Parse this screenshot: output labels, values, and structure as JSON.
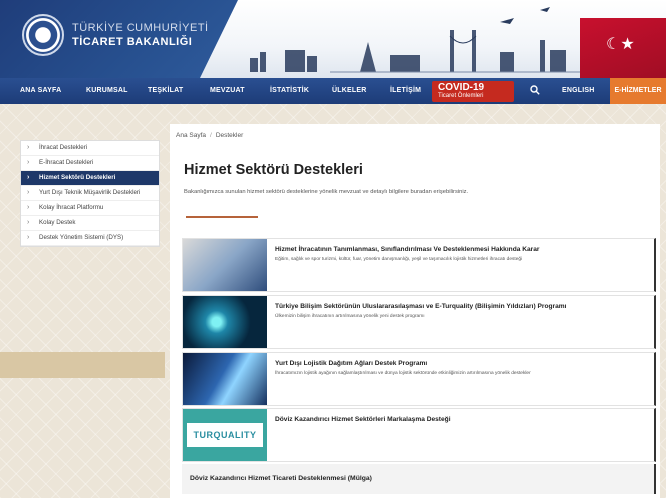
{
  "header": {
    "logo_line1": "TÜRKİYE CUMHURİYETİ",
    "logo_line2": "TİCARET BAKANLIĞI"
  },
  "nav": {
    "items": [
      "ANA SAYFA",
      "KURUMSAL",
      "TEŞKİLAT",
      "MEVZUAT",
      "İSTATİSTİK",
      "ÜLKELER",
      "İLETİŞİM"
    ],
    "covid_big": "COVID-19",
    "covid_small": "Ticaret Önlemleri",
    "english": "ENGLISH",
    "ehizmetler": "E-HİZMETLER"
  },
  "sidebar": {
    "items": [
      "İhracat Destekleri",
      "E-İhracat Destekleri",
      "Hizmet Sektörü Destekleri",
      "Yurt Dışı Teknik Müşavirlik Destekleri",
      "Kolay İhracat Platformu",
      "Kolay Destek",
      "Destek Yönetim Sistemi (DYS)"
    ],
    "active_index": 2
  },
  "breadcrumb": {
    "home": "Ana Sayfa",
    "sep": "/",
    "current": "Destekler"
  },
  "page": {
    "title": "Hizmet Sektörü Destekleri",
    "description": "Bakanlığımızca sunulan hizmet sektörü desteklerine yönelik mevzuat ve detaylı bilgilere buradan erişebilirsiniz."
  },
  "cards": [
    {
      "title": "Hizmet İhracatının Tanımlanması, Sınıflandırılması Ve Desteklenmesi Hakkında Karar",
      "subtitle": "Eğitim, sağlık ve spor turizmi, kültür, fuar, yönetim danışmanlığı, yeşil ve taşımacılık lojistik hizmetleri ihracatı desteği"
    },
    {
      "title": "Türkiye Bilişim Sektörünün Uluslararasılaşması ve E-Turquality (Bilişimin Yıldızları) Programı",
      "subtitle": "Ülkemizin bilişim ihracatının artırılmasına yönelik yeni destek programı"
    },
    {
      "title": "Yurt Dışı Lojistik Dağıtım Ağları Destek Programı",
      "subtitle": "İhracatımızın lojistik ayağının sağlamlaştırılması ve dünya lojistik sektöründe etkinliğimizin artırılmasına yönelik destekler"
    },
    {
      "title": "Döviz Kazandırıcı Hizmet Sektörleri Markalaşma Desteği",
      "subtitle": "",
      "logo_text": "TURQUALITY"
    }
  ],
  "bottom_card": {
    "title": "Döviz Kazandırıcı Hizmet Ticareti Desteklenmesi (Mülga)"
  }
}
